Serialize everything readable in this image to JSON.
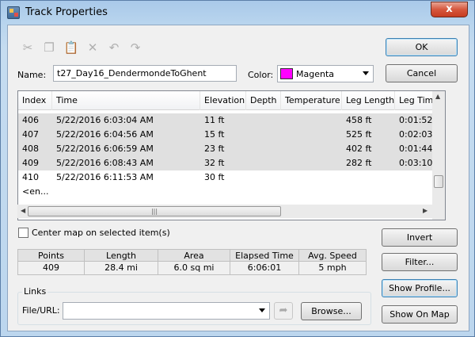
{
  "window": {
    "title": "Track Properties",
    "close_symbol": "x"
  },
  "toolbar": {
    "icons": [
      "scissors-icon",
      "copy-icon",
      "paste-icon",
      "delete-icon",
      "undo-icon",
      "redo-icon"
    ]
  },
  "buttons": {
    "ok": "OK",
    "cancel": "Cancel",
    "invert": "Invert",
    "filter": "Filter...",
    "show_profile": "Show Profile...",
    "show_on_map": "Show On Map",
    "browse": "Browse..."
  },
  "name_field": {
    "label": "Name:",
    "value": "t27_Day16_DendermondeToGhent"
  },
  "color_field": {
    "label": "Color:",
    "value": "Magenta",
    "swatch": "#ff00ff"
  },
  "table": {
    "columns": [
      "Index",
      "Time",
      "Elevation",
      "Depth",
      "Temperature",
      "Leg Length",
      "Leg Time"
    ],
    "rows": [
      {
        "index": "406",
        "time": "5/22/2016 6:03:04 AM",
        "elevation": "11 ft",
        "depth": "",
        "temperature": "",
        "leg_length": "458 ft",
        "leg_time": "0:01:52"
      },
      {
        "index": "407",
        "time": "5/22/2016 6:04:56 AM",
        "elevation": "15 ft",
        "depth": "",
        "temperature": "",
        "leg_length": "525 ft",
        "leg_time": "0:02:03"
      },
      {
        "index": "408",
        "time": "5/22/2016 6:06:59 AM",
        "elevation": "23 ft",
        "depth": "",
        "temperature": "",
        "leg_length": "402 ft",
        "leg_time": "0:01:44"
      },
      {
        "index": "409",
        "time": "5/22/2016 6:08:43 AM",
        "elevation": "32 ft",
        "depth": "",
        "temperature": "",
        "leg_length": "282 ft",
        "leg_time": "0:03:10"
      },
      {
        "index": "410",
        "time": "5/22/2016 6:11:53 AM",
        "elevation": "30 ft",
        "depth": "",
        "temperature": "",
        "leg_length": "",
        "leg_time": ""
      }
    ],
    "end_row": "<en..."
  },
  "center_map": {
    "label": "Center map on selected item(s)",
    "checked": false
  },
  "stats": [
    {
      "label": "Points",
      "value": "409"
    },
    {
      "label": "Length",
      "value": "28.4 mi"
    },
    {
      "label": "Area",
      "value": "6.0 sq mi"
    },
    {
      "label": "Elapsed Time",
      "value": "6:06:01"
    },
    {
      "label": "Avg. Speed",
      "value": "5 mph"
    }
  ],
  "links": {
    "title": "Links",
    "label": "File/URL:",
    "value": ""
  }
}
